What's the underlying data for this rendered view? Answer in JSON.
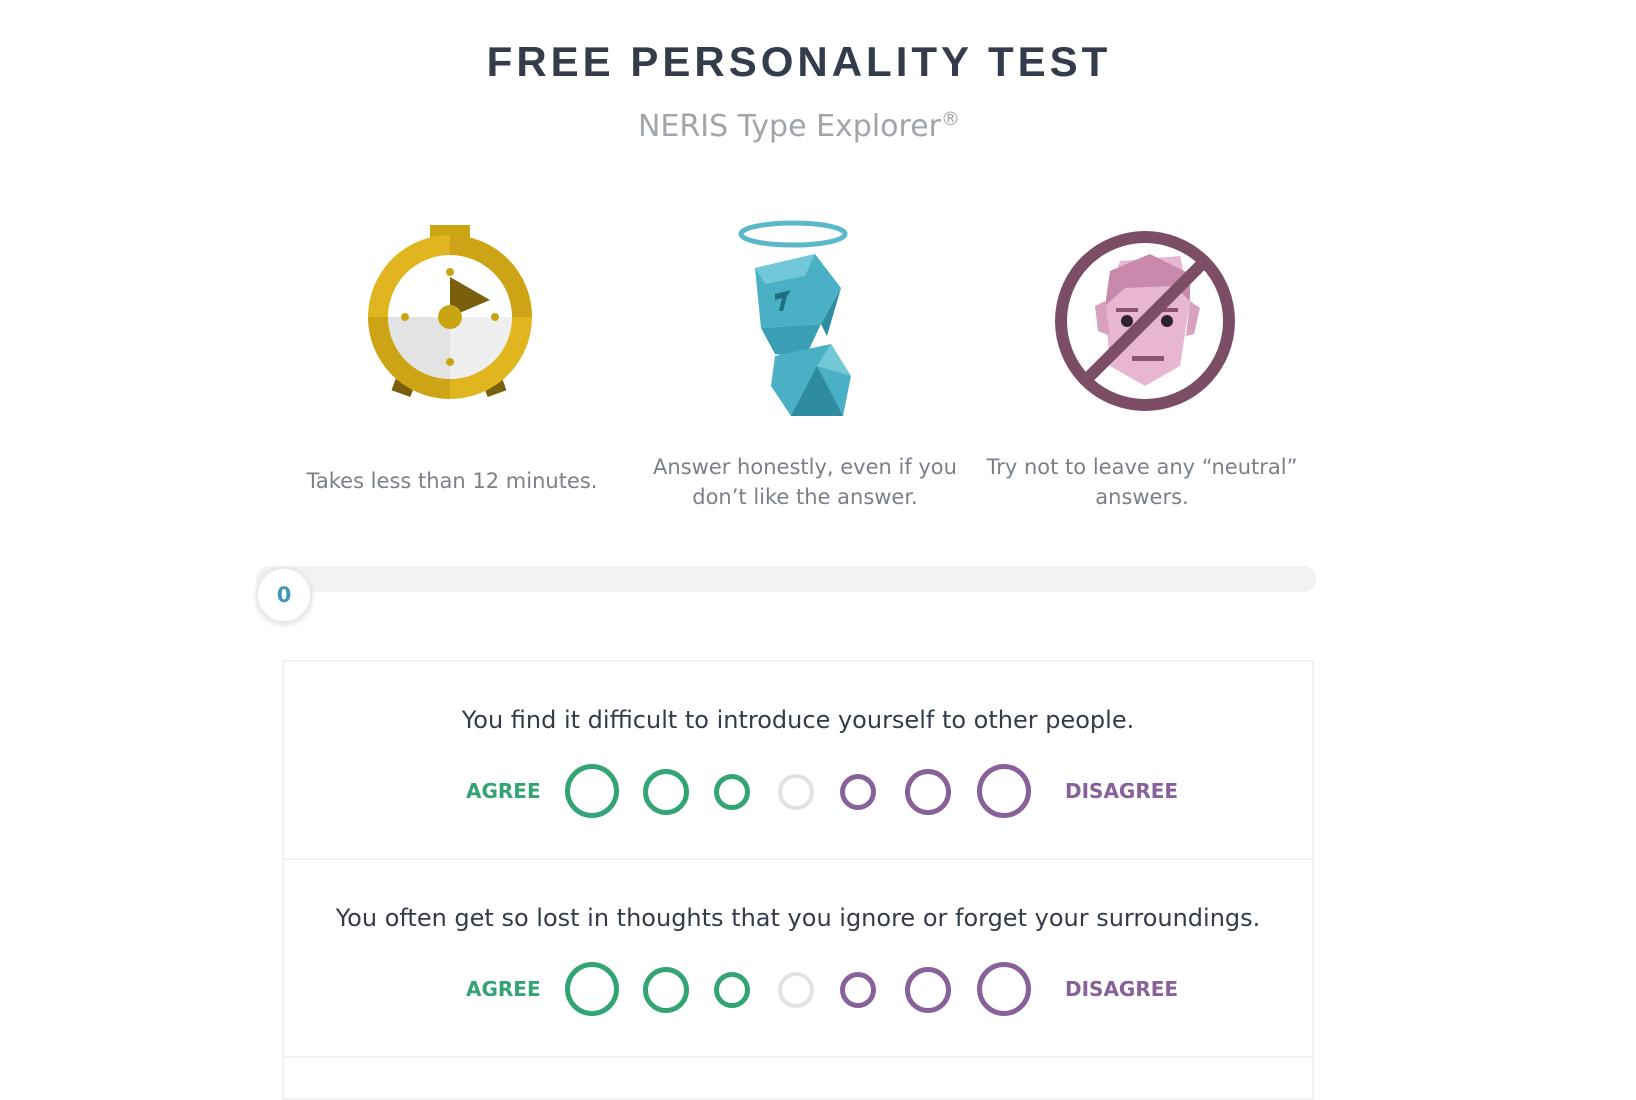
{
  "header": {
    "title": "FREE PERSONALITY TEST",
    "subtitle": "NERIS Type Explorer",
    "subtitle_mark": "®"
  },
  "features": [
    {
      "icon": "stopwatch-icon",
      "text": "Takes less than 12 minutes."
    },
    {
      "icon": "angel-figure-icon",
      "text": "Answer honestly, even if you don’t like the answer."
    },
    {
      "icon": "no-neutral-face-icon",
      "text": "Try not to leave any “neutral” answers."
    }
  ],
  "progress": {
    "value": 0,
    "label": "0"
  },
  "scale": {
    "agree_label": "AGREE",
    "disagree_label": "DISAGREE"
  },
  "questions": [
    {
      "text": "You find it difficult to introduce yourself to other people."
    },
    {
      "text": "You often get so lost in thoughts that you ignore or forget your surroundings."
    }
  ],
  "colors": {
    "agree": "#33a474",
    "disagree": "#88619a",
    "neutral": "#e2e2e2",
    "progress_accent": "#4298b4",
    "title": "#343c4b"
  }
}
